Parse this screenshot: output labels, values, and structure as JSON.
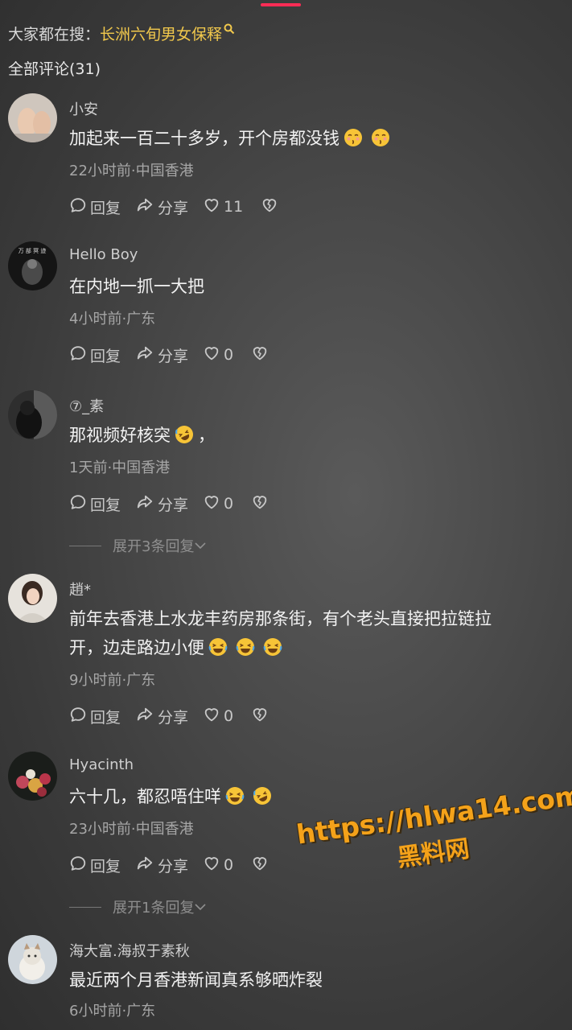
{
  "search": {
    "prefix": "大家都在搜：",
    "keyword": "长洲六旬男女保释"
  },
  "comments_header": "全部评论(31)",
  "actions": {
    "reply": "回复",
    "share": "分享"
  },
  "comments": [
    {
      "name": "小安",
      "text": "加起来一百二十多岁，开个房都没钱",
      "meta": "22小时前·中国香港",
      "likes": "11"
    },
    {
      "name": "Hello Boy",
      "text": "在内地一抓一大把",
      "meta": "4小时前·广东",
      "likes": "0"
    },
    {
      "name": "⑦_素",
      "text": "那视频好核突",
      "text_suffix": "，",
      "meta": "1天前·中国香港",
      "likes": "0",
      "expand": "展开3条回复"
    },
    {
      "name": "趙*",
      "text_line1": "前年去香港上水龙丰药房那条街，有个老头直接把拉链拉",
      "text_line2": "开，边走路边小便",
      "meta": "9小时前·广东",
      "likes": "0"
    },
    {
      "name": "Hyacinth",
      "text": "六十几，都忍唔住咩",
      "meta": "23小时前·中国香港",
      "likes": "0",
      "expand": "展开1条回复"
    },
    {
      "name": "海大富.海叔于素秋",
      "text": "最近两个月香港新闻真系够晒炸裂",
      "meta": "6小时前·广东"
    }
  ],
  "watermark": {
    "url": "https://hlwa14.com",
    "name": "黑料网"
  },
  "colors": {
    "accent": "#fe2c55",
    "keyword": "#f2c94c",
    "watermark": "#f4a21a"
  }
}
